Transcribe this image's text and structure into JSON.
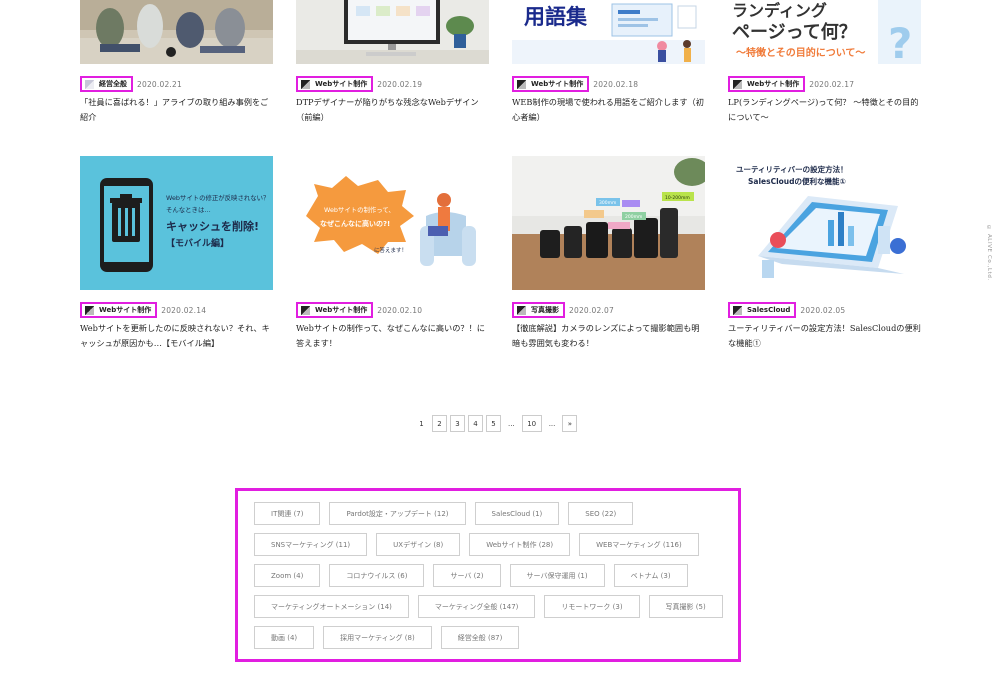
{
  "posts": [
    {
      "category": "経営全般",
      "date": "2020.02.21",
      "title": "「社員に喜ばれる！」アライブの取り組み事例をご紹介"
    },
    {
      "category": "Webサイト制作",
      "date": "2020.02.19",
      "title": "DTPデザイナーが陥りがちな残念なWebデザイン（前編）"
    },
    {
      "category": "Webサイト制作",
      "date": "2020.02.18",
      "title": "WEB制作の現場で使われる用語をご紹介します（初心者編）"
    },
    {
      "category": "Webサイト制作",
      "date": "2020.02.17",
      "title": "LP(ランディングページ)って何？ 〜特徴とその目的について〜"
    },
    {
      "category": "Webサイト制作",
      "date": "2020.02.14",
      "title": "Webサイトを更新したのに反映されない？それ、キャッシュが原因かも…【モバイル編】"
    },
    {
      "category": "Webサイト制作",
      "date": "2020.02.10",
      "title": "Webサイトの制作って、なぜこんなに高いの？！に答えます！"
    },
    {
      "category": "写真撮影",
      "date": "2020.02.07",
      "title": "【徹底解説】カメラのレンズによって撮影範囲も明暗も雰囲気も変わる！"
    },
    {
      "category": "SalesCloud",
      "date": "2020.02.05",
      "title": "ユーティリティバーの設定方法！SalesCloudの便利な機能①"
    }
  ],
  "thumb_text": {
    "yougo": "用語集",
    "lp_line1": "ランディング",
    "lp_line2": "ページって何？",
    "lp_sub": "〜特徴とその目的について〜",
    "cache_q1": "Webサイトの修正が反映されない？",
    "cache_q2": "そんなときは…",
    "cache_main": "キャッシュを削除!",
    "cache_sub": "【モバイル編】",
    "cost_q1": "Webサイトの制作って、",
    "cost_q2": "なぜこんなに高いの?!",
    "cost_ans": "に答えます！",
    "lens_1": "300mm",
    "lens_2": "200mm",
    "lens_3": "10-200mm",
    "sales_line1": "ユーティリティバーの設定方法！",
    "sales_line2": "SalesCloudの便利な機能①"
  },
  "side_copyright": "© ALIVE Co.,Ltd.",
  "pagination": {
    "items": [
      "1",
      "2",
      "3",
      "4",
      "5",
      "...",
      "10",
      "...",
      "»"
    ]
  },
  "tags": [
    [
      "IT関連 (7)",
      "Pardot設定・アップデート (12)",
      "SalesCloud (1)",
      "SEO (22)"
    ],
    [
      "SNSマーケティング (11)",
      "UXデザイン (8)",
      "Webサイト制作 (28)",
      "WEBマーケティング (116)"
    ],
    [
      "Zoom (4)",
      "コロナウイルス (6)",
      "サーバ (2)",
      "サーバ保守運用 (1)",
      "ベトナム (3)"
    ],
    [
      "マーケティングオートメーション (14)",
      "マーケティング全般 (147)",
      "リモートワーク (3)",
      "写真撮影 (5)"
    ],
    [
      "動画 (4)",
      "採用マーケティング (8)",
      "経営全般 (87)"
    ]
  ],
  "colors": {
    "highlight": "#e11ee0",
    "cache_bg": "#5ac2dc",
    "lp_sub": "#f07b3a"
  }
}
